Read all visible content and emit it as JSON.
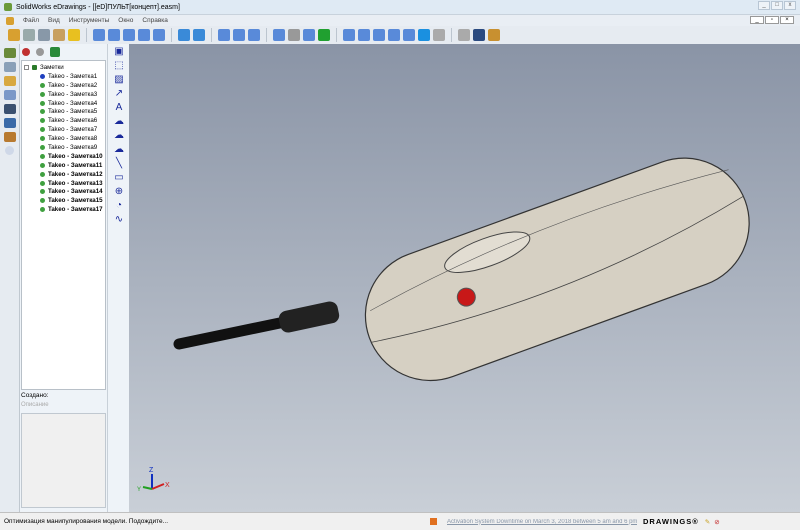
{
  "window": {
    "title": "SolidWorks eDrawings - [[eD]ПУЛЬТ[концепт].easm]"
  },
  "menu": [
    "Файл",
    "Вид",
    "Инструменты",
    "Окно",
    "Справка"
  ],
  "toolbar": {
    "icons": [
      "open-icon",
      "save-icon",
      "print-icon",
      "send-icon",
      "help-icon",
      "zoom-fit-icon",
      "zoom-in-icon",
      "zoom-area-icon",
      "rotate-icon",
      "pan-icon",
      "shaded-icon",
      "perspective-icon",
      "select-icon",
      "home-icon",
      "measure-icon",
      "first-icon",
      "stop-icon",
      "next-icon",
      "play-icon",
      "view-front-icon",
      "view-back-icon",
      "view-left-icon",
      "view-right-icon",
      "view-iso-icon",
      "shaded-cube-icon",
      "ground-icon",
      "section-icon",
      "explode-icon",
      "stamp-icon"
    ]
  },
  "tree": {
    "root": "Заметки",
    "items": [
      "Takeo - Заметка1",
      "Takeo - Заметка2",
      "Takeo - Заметка3",
      "Takeo - Заметка4",
      "Takeo - Заметка5",
      "Takeo - Заметка6",
      "Takeo - Заметка7",
      "Takeo - Заметка8",
      "Takeo - Заметка9",
      "Takeo - Заметка10",
      "Takeo - Заметка11",
      "Takeo - Заметка12",
      "Takeo - Заметка13",
      "Takeo - Заметка14",
      "Takeo - Заметка15",
      "Takeo - Заметка17"
    ]
  },
  "props": {
    "created_label": "Создано:",
    "description_label": "Описание"
  },
  "axes": {
    "z": "Z",
    "x": "X",
    "y": "Y"
  },
  "status": {
    "message": "Оптимизация манипулирования модели. Подождите...",
    "news": "Activation System Downtime on March 3, 2018 between 5 am and 6 pm ES...",
    "brand": "DRAWINGS®"
  }
}
